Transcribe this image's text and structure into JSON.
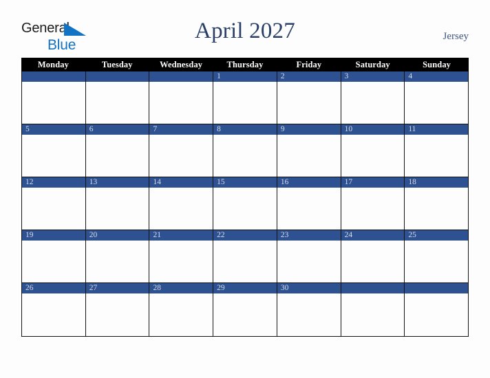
{
  "brand": {
    "name_part1": "General",
    "name_part2": "Blue",
    "triangle_color": "#1273c4",
    "part1_color": "#1b1b1b",
    "part2_color": "#1273c4"
  },
  "header": {
    "title": "April 2027",
    "location": "Jersey",
    "title_color": "#2a3f68",
    "location_color": "#3f5583"
  },
  "calendar": {
    "month": "April",
    "year": "2027",
    "accent_color": "#2e5192",
    "header_bg_color": "#000000",
    "header_text_color": "#ffffff",
    "day_number_color": "#d7dde9",
    "cell_bg_color": "#fdfdfd",
    "border_color": "#111111",
    "weekday_headers": [
      "Monday",
      "Tuesday",
      "Wednesday",
      "Thursday",
      "Friday",
      "Saturday",
      "Sunday"
    ],
    "weeks": [
      [
        {
          "day": ""
        },
        {
          "day": ""
        },
        {
          "day": ""
        },
        {
          "day": "1"
        },
        {
          "day": "2"
        },
        {
          "day": "3"
        },
        {
          "day": "4"
        }
      ],
      [
        {
          "day": "5"
        },
        {
          "day": "6"
        },
        {
          "day": "7"
        },
        {
          "day": "8"
        },
        {
          "day": "9"
        },
        {
          "day": "10"
        },
        {
          "day": "11"
        }
      ],
      [
        {
          "day": "12"
        },
        {
          "day": "13"
        },
        {
          "day": "14"
        },
        {
          "day": "15"
        },
        {
          "day": "16"
        },
        {
          "day": "17"
        },
        {
          "day": "18"
        }
      ],
      [
        {
          "day": "19"
        },
        {
          "day": "20"
        },
        {
          "day": "21"
        },
        {
          "day": "22"
        },
        {
          "day": "23"
        },
        {
          "day": "24"
        },
        {
          "day": "25"
        }
      ],
      [
        {
          "day": "26"
        },
        {
          "day": "27"
        },
        {
          "day": "28"
        },
        {
          "day": "29"
        },
        {
          "day": "30"
        },
        {
          "day": ""
        },
        {
          "day": ""
        }
      ]
    ]
  }
}
